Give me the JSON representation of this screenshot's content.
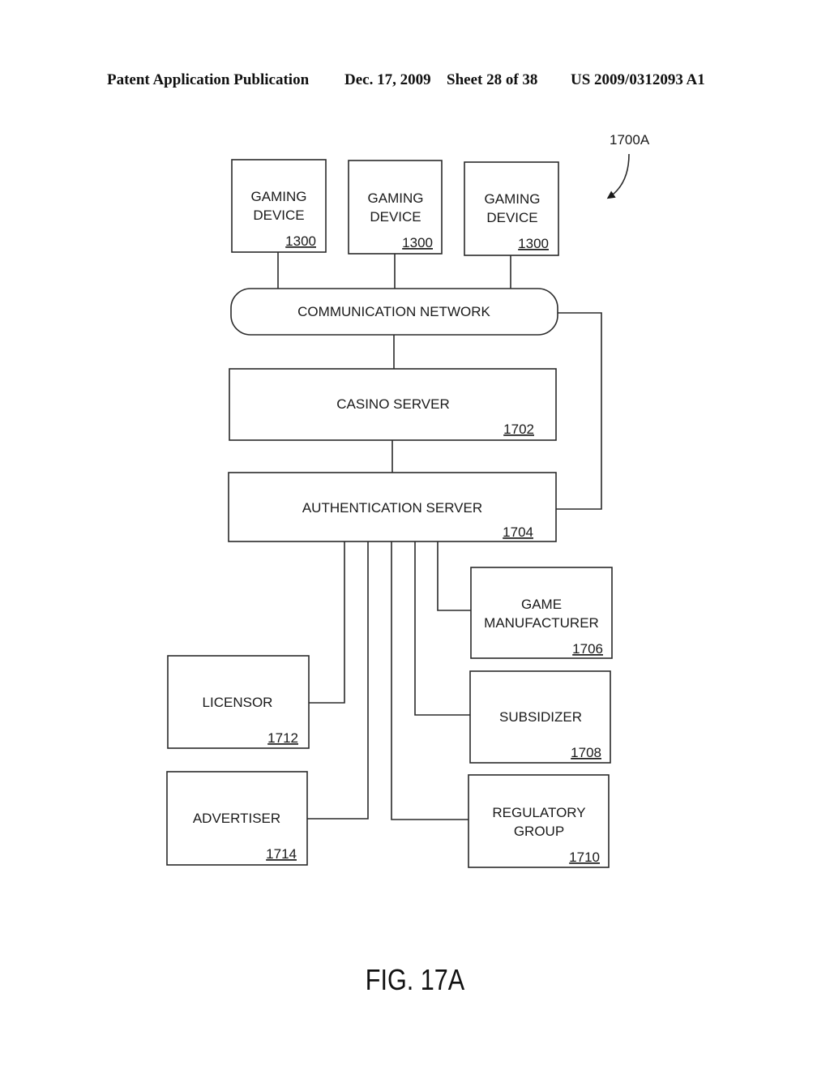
{
  "header": {
    "publication": "Patent Application Publication",
    "date": "Dec. 17, 2009",
    "sheet": "Sheet 28 of 38",
    "patent_number": "US 2009/0312093 A1"
  },
  "figure": {
    "reference": "1700A",
    "caption": "FIG. 17A"
  },
  "nodes": {
    "gaming_device_1": {
      "lines": [
        "GAMING",
        "DEVICE"
      ],
      "ref": "1300"
    },
    "gaming_device_2": {
      "lines": [
        "GAMING",
        "DEVICE"
      ],
      "ref": "1300"
    },
    "gaming_device_3": {
      "lines": [
        "GAMING",
        "DEVICE"
      ],
      "ref": "1300"
    },
    "communication_network": {
      "label": "COMMUNICATION NETWORK"
    },
    "casino_server": {
      "label": "CASINO SERVER",
      "ref": "1702"
    },
    "authentication_server": {
      "label": "AUTHENTICATION SERVER",
      "ref": "1704"
    },
    "game_manufacturer": {
      "lines": [
        "GAME",
        "MANUFACTURER"
      ],
      "ref": "1706"
    },
    "subsidizer": {
      "label": "SUBSIDIZER",
      "ref": "1708"
    },
    "regulatory_group": {
      "lines": [
        "REGULATORY",
        "GROUP"
      ],
      "ref": "1710"
    },
    "licensor": {
      "label": "LICENSOR",
      "ref": "1712"
    },
    "advertiser": {
      "label": "ADVERTISER",
      "ref": "1714"
    }
  },
  "edges": [
    [
      "gaming_device_1",
      "communication_network"
    ],
    [
      "gaming_device_2",
      "communication_network"
    ],
    [
      "gaming_device_3",
      "communication_network"
    ],
    [
      "communication_network",
      "casino_server"
    ],
    [
      "communication_network",
      "authentication_server"
    ],
    [
      "casino_server",
      "authentication_server"
    ],
    [
      "authentication_server",
      "game_manufacturer"
    ],
    [
      "authentication_server",
      "subsidizer"
    ],
    [
      "authentication_server",
      "regulatory_group"
    ],
    [
      "authentication_server",
      "licensor"
    ],
    [
      "authentication_server",
      "advertiser"
    ]
  ]
}
